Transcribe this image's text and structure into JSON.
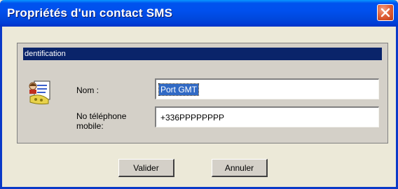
{
  "window": {
    "title": "Propriétés d'un contact SMS"
  },
  "group": {
    "header": "dentification"
  },
  "form": {
    "name_label": "Nom :",
    "name_value": "Port GMT",
    "phone_label": "No téléphone mobile:",
    "phone_value": "+336PPPPPPPP"
  },
  "buttons": {
    "ok_label": "Valider",
    "cancel_label": "Annuler"
  },
  "colors": {
    "titlebar": "#0050ee",
    "group_header": "#0a246a",
    "selection": "#316ac5",
    "close": "#e0623b"
  },
  "icons": {
    "close": "close-icon",
    "contact": "contact-card-icon"
  }
}
